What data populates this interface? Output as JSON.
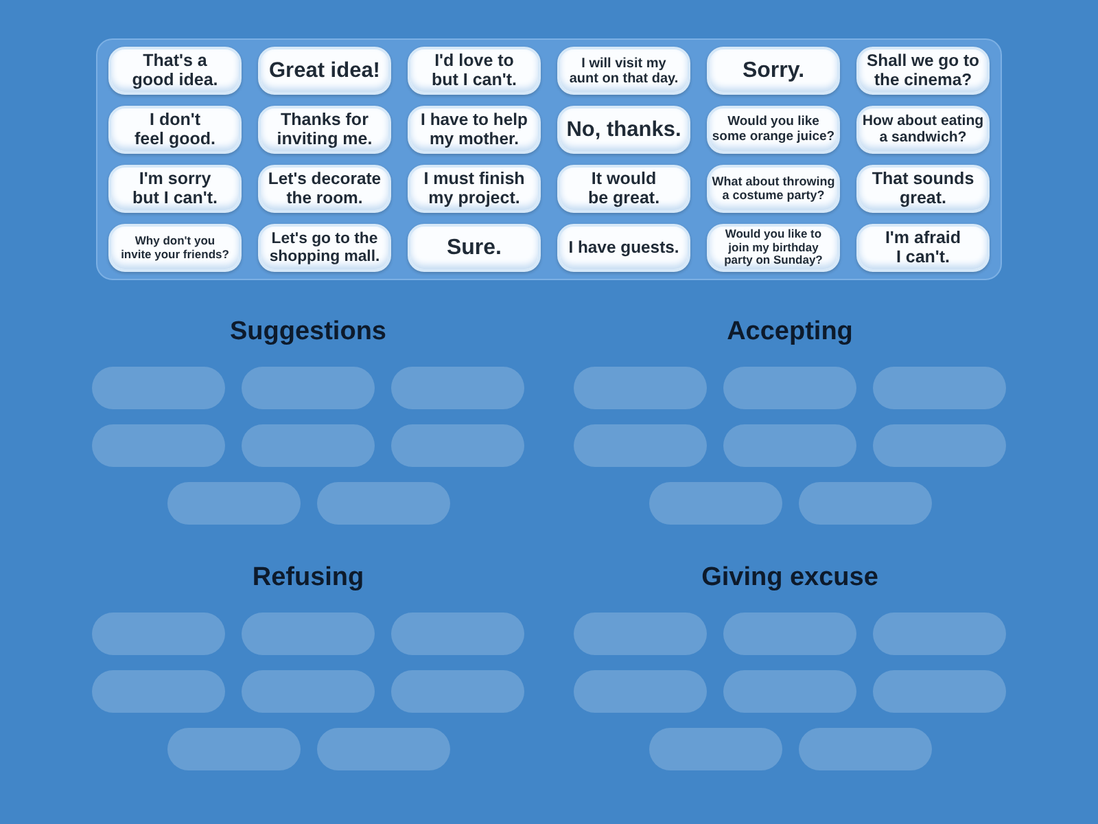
{
  "tray": {
    "cards": [
      {
        "text": "That's a\ngood idea."
      },
      {
        "text": "Great idea!"
      },
      {
        "text": "I'd love to\nbut I can't."
      },
      {
        "text": "I will visit my\naunt on that day."
      },
      {
        "text": "Sorry."
      },
      {
        "text": "Shall we go to\nthe cinema?"
      },
      {
        "text": "I don't\nfeel good."
      },
      {
        "text": "Thanks for\ninviting me."
      },
      {
        "text": "I have to help\nmy mother."
      },
      {
        "text": "No, thanks."
      },
      {
        "text": "Would you like\nsome orange juice?"
      },
      {
        "text": "How about eating\na sandwich?"
      },
      {
        "text": "I'm sorry\nbut I can't."
      },
      {
        "text": "Let's decorate\nthe room."
      },
      {
        "text": "I must finish\nmy project."
      },
      {
        "text": "It would\nbe great."
      },
      {
        "text": "What about throwing\na costume party?"
      },
      {
        "text": "That sounds\ngreat."
      },
      {
        "text": "Why don't you\ninvite your friends?"
      },
      {
        "text": "Let's go to the\nshopping mall."
      },
      {
        "text": "Sure."
      },
      {
        "text": "I have guests."
      },
      {
        "text": "Would you like to\njoin my birthday\nparty on Sunday?"
      },
      {
        "text": "I'm afraid\nI can't."
      }
    ]
  },
  "groups": [
    {
      "title": "Suggestions",
      "slots": [
        {
          "kind": "empty"
        },
        {
          "kind": "empty"
        },
        {
          "kind": "empty"
        },
        {
          "kind": "empty"
        },
        {
          "kind": "empty"
        },
        {
          "kind": "empty"
        },
        {
          "kind": "empty"
        },
        {
          "kind": "empty"
        }
      ]
    },
    {
      "title": "Accepting",
      "slots": [
        {
          "kind": "empty"
        },
        {
          "kind": "empty"
        },
        {
          "kind": "empty"
        },
        {
          "kind": "empty"
        },
        {
          "kind": "empty"
        },
        {
          "kind": "empty"
        },
        {
          "kind": "empty"
        },
        {
          "kind": "empty"
        }
      ]
    },
    {
      "title": "Refusing",
      "slots": [
        {
          "kind": "empty"
        },
        {
          "kind": "empty"
        },
        {
          "kind": "empty"
        },
        {
          "kind": "empty"
        },
        {
          "kind": "empty"
        },
        {
          "kind": "empty"
        },
        {
          "kind": "empty"
        },
        {
          "kind": "empty"
        }
      ]
    },
    {
      "title": "Giving excuse",
      "slots": [
        {
          "kind": "empty"
        },
        {
          "kind": "empty"
        },
        {
          "kind": "empty"
        },
        {
          "kind": "empty"
        },
        {
          "kind": "empty"
        },
        {
          "kind": "empty"
        },
        {
          "kind": "empty"
        },
        {
          "kind": "empty"
        }
      ]
    }
  ]
}
